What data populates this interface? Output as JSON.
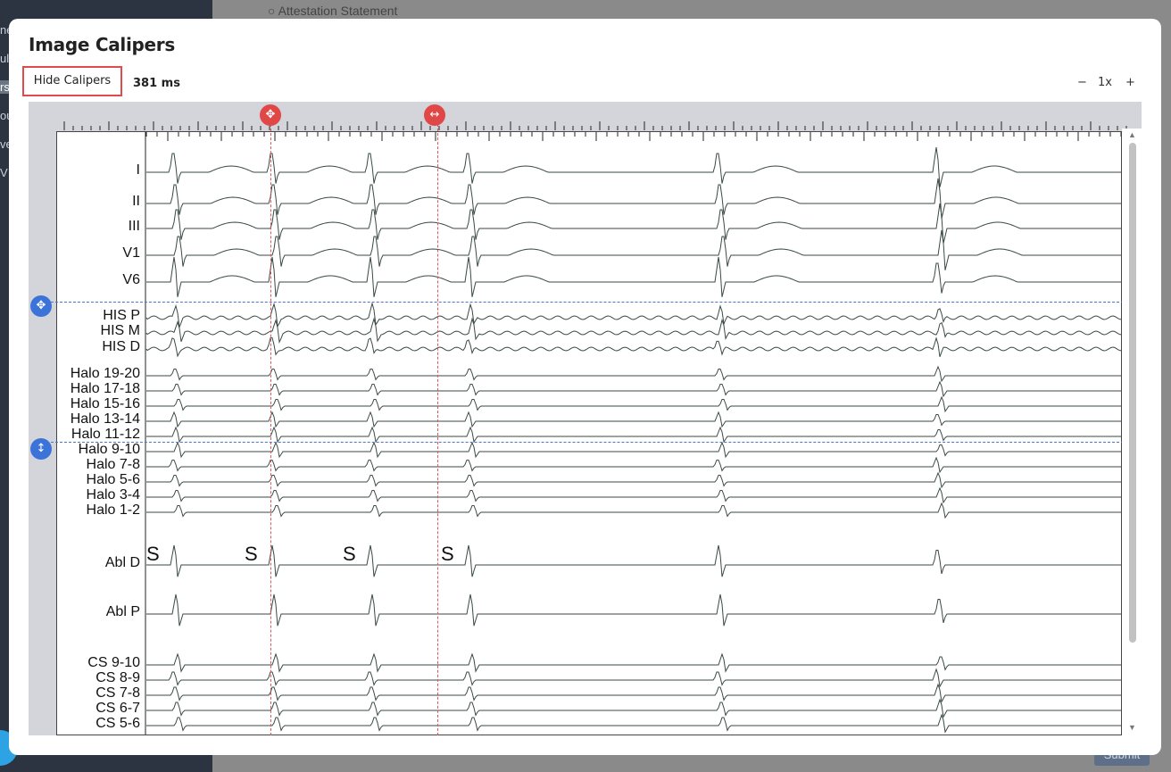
{
  "modal": {
    "title": "Image Calipers"
  },
  "toolbar": {
    "hide_calipers_label": "Hide Calipers",
    "measurement": "381 ms",
    "zoom_out_label": "−",
    "zoom_level": "1x",
    "zoom_in_label": "+"
  },
  "background": {
    "top_text": "Attestation Statement",
    "submit_label": "Submit",
    "sidebar_fragments": [
      "ne",
      "ul",
      "rs",
      "ou",
      "ve",
      "V"
    ]
  },
  "ecg": {
    "leads": [
      "I",
      "II",
      "III",
      "V1",
      "V6",
      "HIS P",
      "HIS M",
      "HIS D",
      "Halo 19-20",
      "Halo 17-18",
      "Halo 15-16",
      "Halo 13-14",
      "Halo 11-12",
      "Halo 9-10",
      "Halo 7-8",
      "Halo 5-6",
      "Halo 3-4",
      "Halo 1-2",
      "Abl D",
      "Abl P",
      "CS 9-10",
      "CS 8-9",
      "CS 7-8",
      "CS 6-7",
      "CS 5-6"
    ],
    "stim_marker": "S"
  },
  "calipers": {
    "vertical_handle_icon": "move-icon",
    "range_handle_icon": "horizontal-arrows-icon",
    "horizontal_move_icon": "move-icon",
    "horizontal_range_icon": "vertical-arrows-icon",
    "color_time": "#e04848",
    "color_amplitude": "#3b73d8"
  }
}
